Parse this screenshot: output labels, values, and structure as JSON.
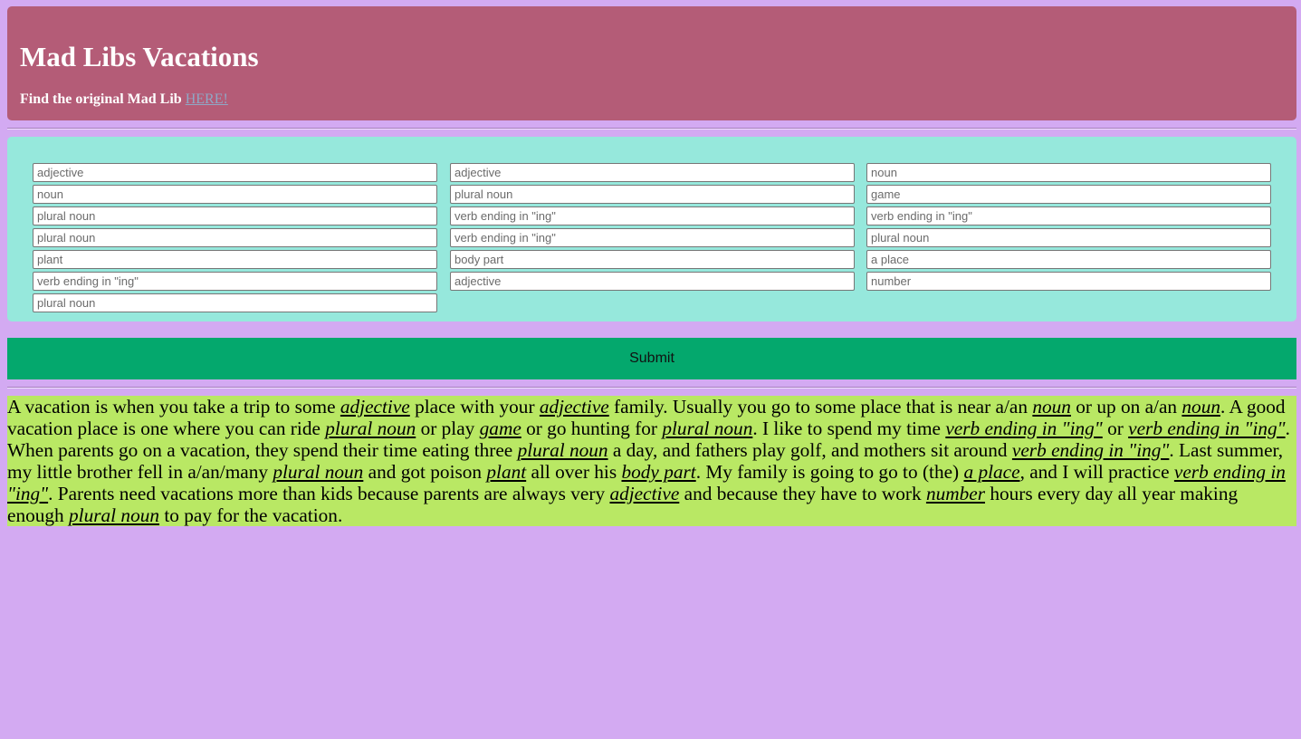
{
  "header": {
    "title": "Mad Libs Vacations",
    "subtitle_prefix": "Find the original Mad Lib ",
    "link_text": "HERE!"
  },
  "form": {
    "col1": [
      "adjective",
      "noun",
      "plural noun",
      "plural noun",
      "plant",
      "verb ending in \"ing\"",
      "plural noun"
    ],
    "col2": [
      "adjective",
      "plural noun",
      "verb ending in \"ing\"",
      "verb ending in \"ing\"",
      "body part",
      "adjective"
    ],
    "col3": [
      "noun",
      "game",
      "verb ending in \"ing\"",
      "plural noun",
      "a place",
      "number"
    ],
    "submit_label": "Submit"
  },
  "story": {
    "segments": [
      {
        "t": "A vacation is when you take a trip to some "
      },
      {
        "b": "adjective"
      },
      {
        "t": " place with your "
      },
      {
        "b": "adjective"
      },
      {
        "t": " family. Usually you go to some place that is near a/an "
      },
      {
        "b": "noun"
      },
      {
        "t": " or up on a/an "
      },
      {
        "b": "noun"
      },
      {
        "t": ". A good vacation place is one where you can ride "
      },
      {
        "b": "plural noun"
      },
      {
        "t": " or play "
      },
      {
        "b": "game"
      },
      {
        "t": " or go hunting for "
      },
      {
        "b": "plural noun"
      },
      {
        "t": ". I like to spend my time "
      },
      {
        "b": "verb ending in \"ing\""
      },
      {
        "t": " or "
      },
      {
        "b": "verb ending in \"ing\""
      },
      {
        "t": ". When parents go on a vacation, they spend their time eating three "
      },
      {
        "b": "plural noun"
      },
      {
        "t": " a day, and fathers play golf, and mothers sit around "
      },
      {
        "b": "verb ending in \"ing\""
      },
      {
        "t": ". Last summer, my little brother fell in a/an/many "
      },
      {
        "b": "plural noun"
      },
      {
        "t": " and got poison "
      },
      {
        "b": "plant"
      },
      {
        "t": " all over his "
      },
      {
        "b": "body part"
      },
      {
        "t": ". My family is going to go to (the) "
      },
      {
        "b": "a place"
      },
      {
        "t": ", and I will practice "
      },
      {
        "b": "verb ending in \"ing\""
      },
      {
        "t": ". Parents need vacations more than kids because parents are always very "
      },
      {
        "b": "adjective"
      },
      {
        "t": " and because they have to work "
      },
      {
        "b": "number"
      },
      {
        "t": " hours every day all year making enough "
      },
      {
        "b": "plural noun"
      },
      {
        "t": " to pay for the vacation."
      }
    ]
  },
  "colors": {
    "page_bg": "#d3aaf2",
    "header_bg": "#b45c77",
    "form_bg": "#96e8dc",
    "submit_bg": "#04a86d",
    "story_bg": "#b9e864"
  }
}
